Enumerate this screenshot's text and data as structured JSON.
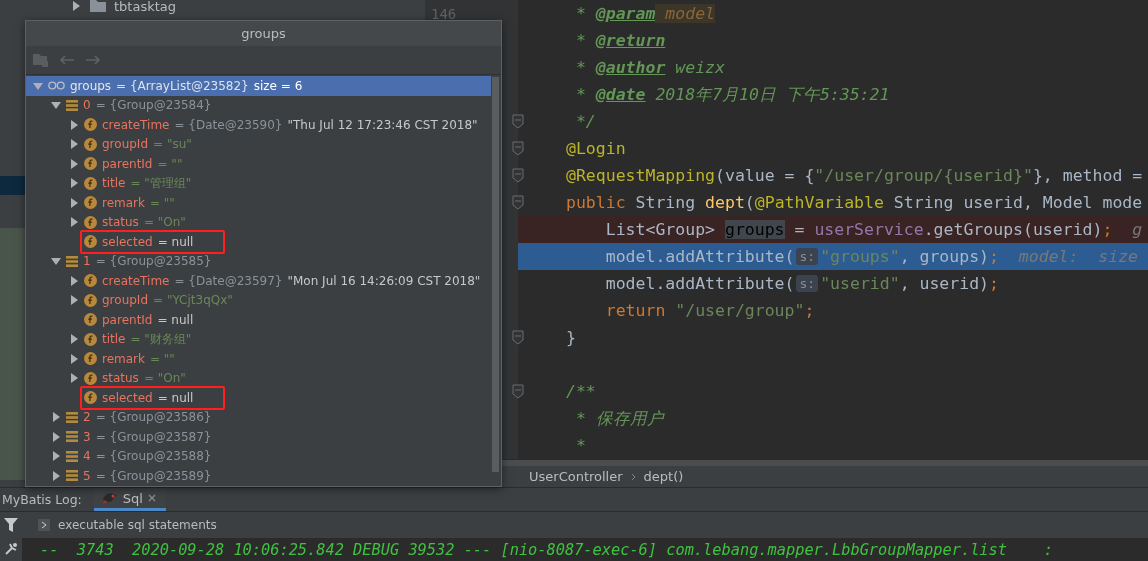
{
  "project_tree": {
    "items": [
      {
        "label": "tbtasktag",
        "expanded": false
      }
    ]
  },
  "editor": {
    "lines": [
      {
        "number": "146",
        "fold": false,
        "breakpoint": false,
        "current": false,
        "tokens": [
          {
            "kind": "comment",
            "text": " * "
          },
          {
            "kind": "doctag",
            "text": "@param"
          },
          {
            "kind": "paramref",
            "text": " model"
          }
        ]
      },
      {
        "fold": false,
        "breakpoint": false,
        "current": false,
        "tokens": [
          {
            "kind": "comment",
            "text": " * "
          },
          {
            "kind": "doctag",
            "text": "@return"
          }
        ]
      },
      {
        "fold": false,
        "breakpoint": false,
        "current": false,
        "tokens": [
          {
            "kind": "comment",
            "text": " * "
          },
          {
            "kind": "doctag",
            "text": "@author"
          },
          {
            "kind": "comment",
            "text": " weizx"
          }
        ]
      },
      {
        "fold": false,
        "breakpoint": false,
        "current": false,
        "tokens": [
          {
            "kind": "comment",
            "text": " * "
          },
          {
            "kind": "doctag",
            "text": "@date"
          },
          {
            "kind": "comment",
            "text": " 2018年7月10日 下午5:35:21"
          }
        ]
      },
      {
        "fold": true,
        "breakpoint": false,
        "current": false,
        "tokens": [
          {
            "kind": "comment",
            "text": " */"
          }
        ]
      },
      {
        "fold": true,
        "breakpoint": false,
        "current": false,
        "tokens": [
          {
            "kind": "annotation",
            "text": "@Login"
          }
        ]
      },
      {
        "fold": true,
        "breakpoint": false,
        "current": false,
        "tokens": [
          {
            "kind": "annotation",
            "text": "@RequestMapping"
          },
          {
            "kind": "plain",
            "text": "(value = {"
          },
          {
            "kind": "string",
            "text": "\"/user/group/{userid}\""
          },
          {
            "kind": "plain",
            "text": "}, method ="
          }
        ]
      },
      {
        "fold": true,
        "breakpoint": false,
        "current": false,
        "tokens": [
          {
            "kind": "keyword",
            "text": "public "
          },
          {
            "kind": "plain",
            "text": "String "
          },
          {
            "kind": "method",
            "text": "dept"
          },
          {
            "kind": "plain",
            "text": "("
          },
          {
            "kind": "annotation",
            "text": "@PathVariable"
          },
          {
            "kind": "plain",
            "text": " String userid, Model mode"
          }
        ]
      },
      {
        "fold": false,
        "breakpoint": true,
        "current": false,
        "tokens": [
          {
            "kind": "plain",
            "text": "    List<Group> "
          },
          {
            "kind": "usage",
            "text": "groups"
          },
          {
            "kind": "plain",
            "text": " = "
          },
          {
            "kind": "field",
            "text": "userService"
          },
          {
            "kind": "plain",
            "text": ".getGroups(userid)"
          },
          {
            "kind": "keyword",
            "text": ";"
          },
          {
            "kind": "inline",
            "text": "  g"
          }
        ]
      },
      {
        "fold": false,
        "breakpoint": false,
        "current": true,
        "tokens": [
          {
            "kind": "plain",
            "text": "    model.addAttribute("
          },
          {
            "kind": "hint",
            "text": "s:"
          },
          {
            "kind": "string",
            "text": "\"groups\""
          },
          {
            "kind": "plain",
            "text": ", groups)"
          },
          {
            "kind": "keyword",
            "text": ";"
          },
          {
            "kind": "inline",
            "text": "  model:  size"
          }
        ]
      },
      {
        "fold": false,
        "breakpoint": false,
        "current": false,
        "tokens": [
          {
            "kind": "plain",
            "text": "    model.addAttribute("
          },
          {
            "kind": "hint",
            "text": "s:"
          },
          {
            "kind": "string",
            "text": "\"userid\""
          },
          {
            "kind": "plain",
            "text": ", userid)"
          },
          {
            "kind": "keyword",
            "text": ";"
          }
        ]
      },
      {
        "fold": false,
        "breakpoint": false,
        "current": false,
        "tokens": [
          {
            "kind": "keyword",
            "text": "    return "
          },
          {
            "kind": "string",
            "text": "\"/user/group\""
          },
          {
            "kind": "keyword",
            "text": ";"
          }
        ]
      },
      {
        "fold": true,
        "breakpoint": false,
        "current": false,
        "tokens": [
          {
            "kind": "plain",
            "text": "}"
          }
        ]
      },
      {
        "fold": false,
        "breakpoint": false,
        "current": false
      },
      {
        "fold": true,
        "breakpoint": false,
        "current": false,
        "tokens": [
          {
            "kind": "comment",
            "text": "/**"
          }
        ]
      },
      {
        "fold": false,
        "breakpoint": false,
        "current": false,
        "tokens": [
          {
            "kind": "comment",
            "text": " * 保存用户"
          }
        ]
      },
      {
        "fold": false,
        "breakpoint": false,
        "current": false,
        "tokens": [
          {
            "kind": "comment",
            "text": " *"
          }
        ]
      }
    ]
  },
  "breadcrumb": [
    "UserController",
    "dept()"
  ],
  "debug_popup": {
    "title": "groups",
    "tree": [
      {
        "kind": "watch",
        "name": "groups",
        "ref": "= {ArrayList@23582}",
        "value": {
          "kind": "plain",
          "text": "size = 6"
        },
        "expanded": true,
        "selected": true,
        "marked": false,
        "children": [
          {
            "kind": "element",
            "name": "0",
            "ref": "= {Group@23584}",
            "expanded": true,
            "selected": false,
            "marked": false,
            "children": [
              {
                "kind": "field",
                "name": "createTime",
                "ref": "= {Date@23590}",
                "value": {
                  "kind": "plain",
                  "text": "\"Thu Jul 12 17:23:46 CST 2018\""
                },
                "expanded": false,
                "selected": false,
                "marked": false
              },
              {
                "kind": "field",
                "name": "groupId",
                "value": {
                  "kind": "string",
                  "text": "= \"su\""
                },
                "expanded": false,
                "selected": false,
                "marked": false
              },
              {
                "kind": "field",
                "name": "parentId",
                "value": {
                  "kind": "string",
                  "text": "= \"\""
                },
                "expanded": false,
                "selected": false,
                "marked": false
              },
              {
                "kind": "field",
                "name": "title",
                "value": {
                  "kind": "string",
                  "text": "= \"管理组\""
                },
                "expanded": false,
                "selected": false,
                "marked": false
              },
              {
                "kind": "field",
                "name": "remark",
                "value": {
                  "kind": "string",
                  "text": "= \"\""
                },
                "expanded": false,
                "selected": false,
                "marked": false
              },
              {
                "kind": "field",
                "name": "status",
                "value": {
                  "kind": "string",
                  "text": "= \"On\""
                },
                "expanded": false,
                "selected": false,
                "marked": false
              },
              {
                "kind": "field",
                "name": "selected",
                "value": {
                  "kind": "plain",
                  "text": "= null"
                },
                "selected": false,
                "marked": true
              }
            ]
          },
          {
            "kind": "element",
            "name": "1",
            "ref": "= {Group@23585}",
            "expanded": true,
            "selected": false,
            "marked": false,
            "children": [
              {
                "kind": "field",
                "name": "createTime",
                "ref": "= {Date@23597}",
                "value": {
                  "kind": "plain",
                  "text": "\"Mon Jul 16 14:26:09 CST 2018\""
                },
                "expanded": false,
                "selected": false,
                "marked": false
              },
              {
                "kind": "field",
                "name": "groupId",
                "value": {
                  "kind": "string",
                  "text": "= \"YCjt3qQx\""
                },
                "expanded": false,
                "selected": false,
                "marked": false
              },
              {
                "kind": "field",
                "name": "parentId",
                "value": {
                  "kind": "plain",
                  "text": "= null"
                },
                "selected": false,
                "marked": false
              },
              {
                "kind": "field",
                "name": "title",
                "value": {
                  "kind": "string",
                  "text": "= \"财务组\""
                },
                "expanded": false,
                "selected": false,
                "marked": false
              },
              {
                "kind": "field",
                "name": "remark",
                "value": {
                  "kind": "string",
                  "text": "= \"\""
                },
                "expanded": false,
                "selected": false,
                "marked": false
              },
              {
                "kind": "field",
                "name": "status",
                "value": {
                  "kind": "string",
                  "text": "= \"On\""
                },
                "expanded": false,
                "selected": false,
                "marked": false
              },
              {
                "kind": "field",
                "name": "selected",
                "value": {
                  "kind": "plain",
                  "text": "= null"
                },
                "selected": false,
                "marked": true
              }
            ]
          },
          {
            "kind": "element",
            "name": "2",
            "ref": "= {Group@23586}",
            "expanded": false,
            "selected": false,
            "marked": false
          },
          {
            "kind": "element",
            "name": "3",
            "ref": "= {Group@23587}",
            "expanded": false,
            "selected": false,
            "marked": false
          },
          {
            "kind": "element",
            "name": "4",
            "ref": "= {Group@23588}",
            "expanded": false,
            "selected": false,
            "marked": false
          },
          {
            "kind": "element",
            "name": "5",
            "ref": "= {Group@23589}",
            "expanded": false,
            "selected": false,
            "marked": false
          }
        ]
      }
    ]
  },
  "bottom_panel": {
    "label": "MyBatis Log:",
    "tabs": [
      {
        "label": "Sql",
        "selected": true
      }
    ],
    "group": "executable sql statements",
    "log": "--  3743  2020-09-28 10:06:25.842 DEBUG 39532 --- [nio-8087-exec-6] com.lebang.mapper.LbbGroupMapper.list    :"
  }
}
